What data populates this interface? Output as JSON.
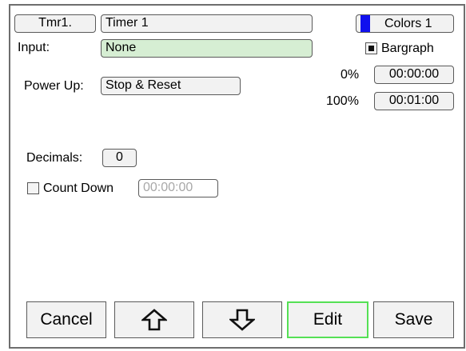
{
  "timer": {
    "tab_label": "Tmr1.",
    "name": "Timer 1"
  },
  "colors": {
    "label": "Colors 1",
    "swatch_color": "#1010ee"
  },
  "input": {
    "label": "Input:",
    "value": "None"
  },
  "bargraph": {
    "label": "Bargraph",
    "checked": true
  },
  "power_up": {
    "label": "Power Up:",
    "value": "Stop & Reset"
  },
  "scale": {
    "low_label": "0%",
    "low_value": "00:00:00",
    "high_label": "100%",
    "high_value": "00:01:00"
  },
  "decimals": {
    "label": "Decimals:",
    "value": "0"
  },
  "count_down": {
    "label": "Count Down",
    "checked": false,
    "value": "00:00:00"
  },
  "buttons": {
    "cancel": "Cancel",
    "up_icon": "arrow-up-icon",
    "down_icon": "arrow-down-icon",
    "edit": "Edit",
    "save": "Save"
  }
}
